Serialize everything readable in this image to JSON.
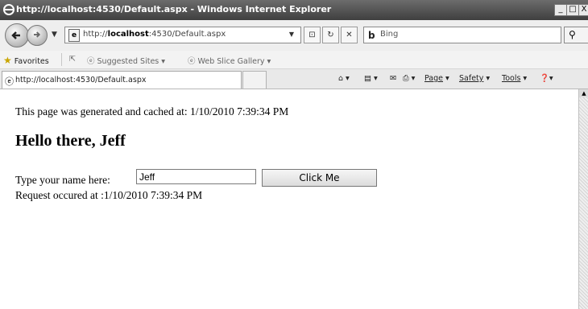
{
  "window": {
    "title": "http://localhost:4530/Default.aspx - Windows Internet Explorer",
    "minimize": "_",
    "maximize": "□",
    "close": "X"
  },
  "addressbar": {
    "url_bold": "localhost",
    "url_prefix": "http://",
    "url_suffix": ":4530/Default.aspx",
    "search_placeholder": "Bing"
  },
  "favorites": {
    "label": "Favorites",
    "suggested": "Suggested Sites",
    "webslice": "Web Slice Gallery"
  },
  "tab": {
    "title": "http://localhost:4530/Default.aspx"
  },
  "commandbar": {
    "page": "Page",
    "safety": "Safety",
    "tools": "Tools"
  },
  "page": {
    "cached_text": "This page was generated and cached at: 1/10/2010 7:39:34 PM",
    "greeting": "Hello there, Jeff",
    "prompt_label": "Type your name here:",
    "name_value": "Jeff",
    "button_label": "Click Me",
    "request_text": "Request occured at :1/10/2010 7:39:34 PM"
  }
}
